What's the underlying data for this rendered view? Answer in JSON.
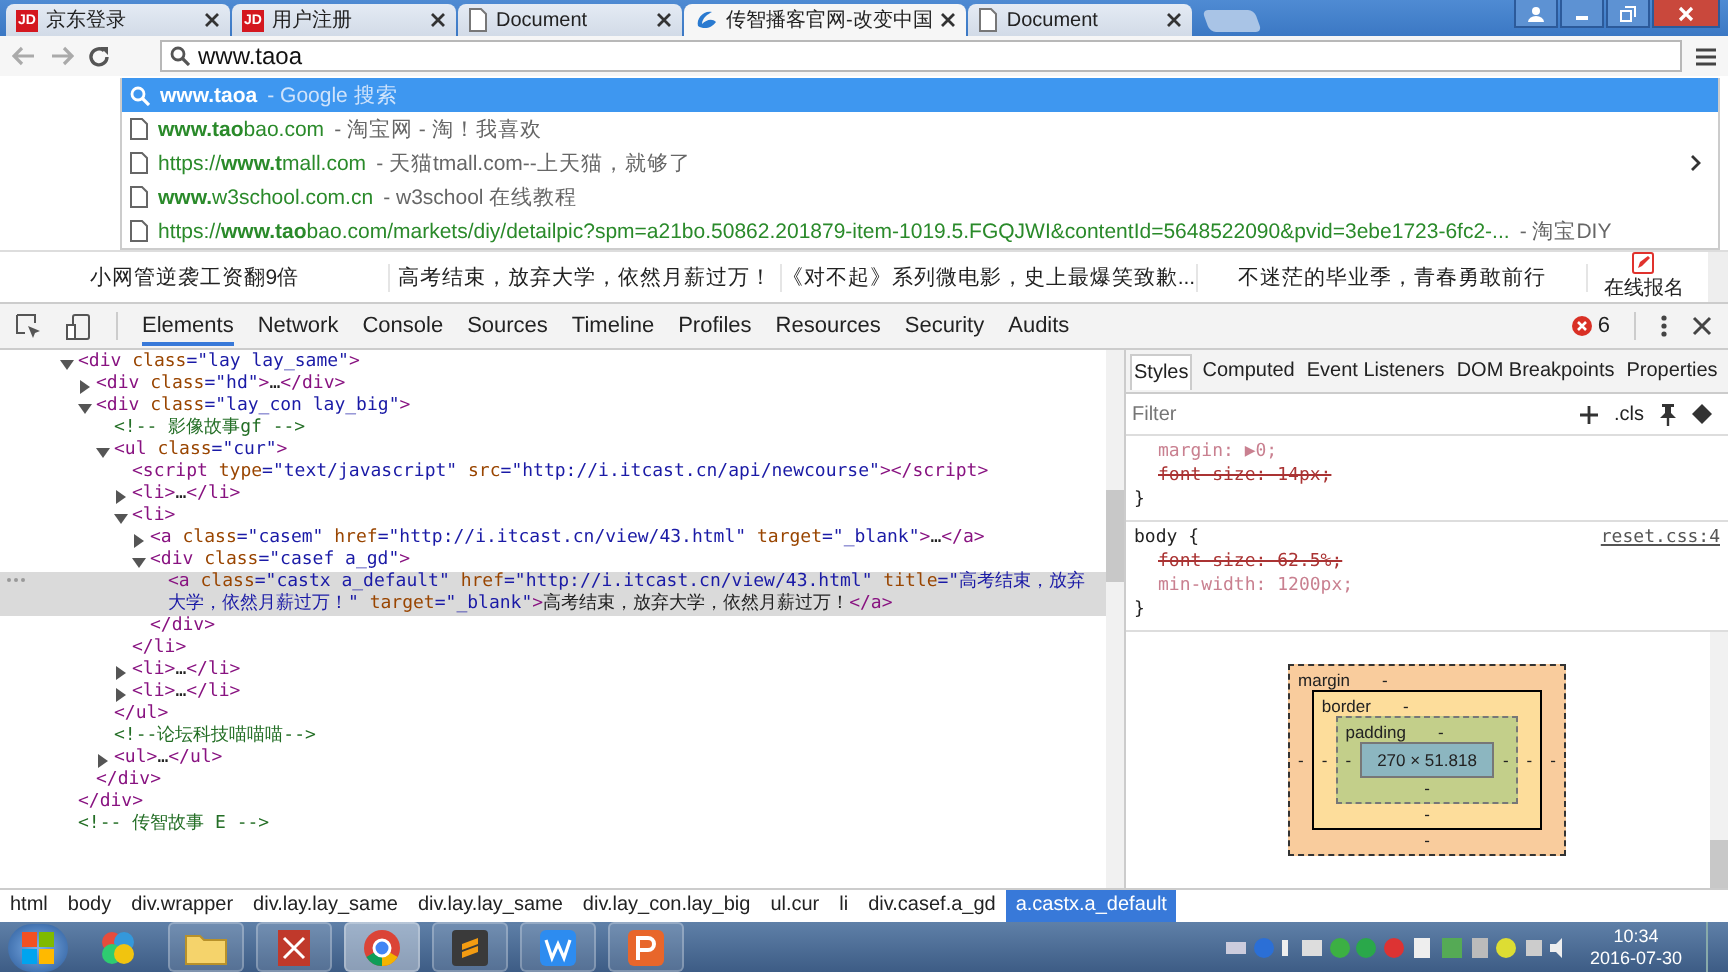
{
  "browser": {
    "tabs": [
      {
        "title": "京东登录",
        "kind": "logo",
        "badge": "JD",
        "selected": false
      },
      {
        "title": "用户注册",
        "kind": "logo",
        "badge": "JD",
        "selected": false
      },
      {
        "title": "Document",
        "kind": "document",
        "selected": false
      },
      {
        "title": "传智播客官网-改变中国",
        "kind": "swirl",
        "selected": true
      },
      {
        "title": "Document",
        "kind": "document",
        "selected": false
      }
    ],
    "omnibox": {
      "value": "www.taoa"
    },
    "suggestions": [
      {
        "kind": "search",
        "text": "**www.taoa**",
        "description": " - Google 搜索",
        "selected": true,
        "arrow": false
      },
      {
        "kind": "page",
        "text": "**www.tao**bao.com",
        "description": " - 淘宝网 - 淘！我喜欢",
        "selected": false,
        "arrow": false
      },
      {
        "kind": "page",
        "text": "https://**www.t**mall.com",
        "description": " - 天猫tmall.com--上天猫，就够了",
        "selected": false,
        "arrow": true
      },
      {
        "kind": "page",
        "text": "**www.**w3school.com.cn",
        "description": " - w3school 在线教程",
        "selected": false,
        "arrow": false
      },
      {
        "kind": "page",
        "text": "https://**www.tao**bao.com/markets/diy/detailpic?spm=a21bo.50862.201879-item-1019.5.FGQJWI&contentId=5648522090&pvid=3ebe1723-6fc2-...",
        "description": " - 淘宝DIY",
        "selected": false,
        "arrow": false
      }
    ]
  },
  "page": {
    "headlines": [
      "小网管逆袭工资翻9倍",
      "高考结束，放弃大学，依然月薪过万！",
      "《对不起》系列微电影，史上最爆笑致歉...",
      "不迷茫的毕业季，青春勇敢前行"
    ],
    "signup": "在线报名"
  },
  "devtools": {
    "tabs": [
      {
        "label": "Elements",
        "selected": true
      },
      {
        "label": "Network",
        "selected": false
      },
      {
        "label": "Console",
        "selected": false
      },
      {
        "label": "Sources",
        "selected": false
      },
      {
        "label": "Timeline",
        "selected": false
      },
      {
        "label": "Profiles",
        "selected": false
      },
      {
        "label": "Resources",
        "selected": false
      },
      {
        "label": "Security",
        "selected": false
      },
      {
        "label": "Audits",
        "selected": false
      }
    ],
    "error_count": "6",
    "tree": [
      {
        "markup": "<div class=\"lay lay_same\">",
        "expanded": true,
        "selected": false,
        "close": "</div>",
        "children": [
          {
            "markup": "<div class=\"hd\">…</div>",
            "expanded": false,
            "selected": false
          },
          {
            "markup": "<div class=\"lay_con lay_big\">",
            "expanded": true,
            "selected": false,
            "close": "</div>",
            "children": [
              {
                "markup": "<!-- 影像故事gf -->",
                "selected": false
              },
              {
                "markup": "<ul class=\"cur\">",
                "expanded": true,
                "selected": false,
                "close": "</ul>",
                "children": [
                  {
                    "markup": "<script type=\"text/javascript\" src=\"http://i.itcast.cn/api/newcourse\"></script>",
                    "selected": false
                  },
                  {
                    "markup": "<li>…</li>",
                    "expanded": false,
                    "selected": false
                  },
                  {
                    "markup": "<li>",
                    "expanded": true,
                    "selected": false,
                    "close": "</li>",
                    "children": [
                      {
                        "markup": "<a class=\"casem\" href=\"http://i.itcast.cn/view/43.html\" target=\"_blank\">…</a>",
                        "expanded": false,
                        "selected": false
                      },
                      {
                        "markup": "<div class=\"casef a_gd\">",
                        "expanded": true,
                        "selected": false,
                        "close": "</div>",
                        "children": [
                          {
                            "markup": "<a class=\"castx a_default\" href=\"http://i.itcast.cn/view/43.html\" title=\"高考结束，放弃大学，依然月薪过万！\" target=\"_blank\">高考结束，放弃大学，依然月薪过万！</a>",
                            "selected": true
                          }
                        ]
                      }
                    ]
                  },
                  {
                    "markup": "<li>…</li>",
                    "expanded": false,
                    "selected": false
                  },
                  {
                    "markup": "<li>…</li>",
                    "expanded": false,
                    "selected": false
                  }
                ]
              },
              {
                "markup": "<!--论坛科技喵喵喵-->",
                "selected": false
              },
              {
                "markup": "<ul>…</ul>",
                "expanded": false,
                "selected": false
              }
            ]
          }
        ]
      },
      {
        "markup": "<!-- 传智故事 E -->",
        "selected": false
      }
    ],
    "breadcrumbs": [
      {
        "label": "html",
        "selected": false
      },
      {
        "label": "body",
        "selected": false
      },
      {
        "label": "div.wrapper",
        "selected": false
      },
      {
        "label": "div.lay.lay_same",
        "selected": false
      },
      {
        "label": "div.lay.lay_same",
        "selected": false
      },
      {
        "label": "div.lay_con.lay_big",
        "selected": false
      },
      {
        "label": "ul.cur",
        "selected": false
      },
      {
        "label": "li",
        "selected": false
      },
      {
        "label": "div.casef.a_gd",
        "selected": false
      },
      {
        "label": "a.castx.a_default",
        "selected": true
      }
    ],
    "side_tabs": [
      {
        "label": "Styles",
        "selected": true
      },
      {
        "label": "Computed",
        "selected": false
      },
      {
        "label": "Event Listeners",
        "selected": false
      },
      {
        "label": "DOM Breakpoints",
        "selected": false
      },
      {
        "label": "Properties",
        "selected": false
      }
    ],
    "filter": {
      "placeholder": "Filter"
    },
    "cls": ".cls",
    "rules": [
      {
        "props": [
          {
            "text": "margin: ▶0;",
            "overridden": false
          },
          {
            "text": "font-size: 14px;",
            "overridden": true
          }
        ],
        "close": "}"
      },
      {
        "open": "body {",
        "source": "reset.css:4",
        "props": [
          {
            "text": "font-size: 62.5%;",
            "overridden": true
          },
          {
            "text": "min-width: 1200px;",
            "overridden": false
          }
        ],
        "close": "}"
      }
    ],
    "box_model": {
      "margin": {
        "label": "margin",
        "top": "-",
        "right": "-",
        "bottom": "-",
        "left": "-"
      },
      "border": {
        "label": "border",
        "top": "-",
        "right": "-",
        "bottom": "-",
        "left": "-"
      },
      "padding": {
        "label": "padding",
        "top": "-",
        "right": "-",
        "bottom": "-",
        "left": "-"
      },
      "content": "270 × 51.818"
    }
  },
  "taskbar": {
    "apps": [
      {
        "kind": "folder",
        "active": false
      },
      {
        "kind": "pdf",
        "active": false
      },
      {
        "kind": "browser",
        "active": true
      },
      {
        "kind": "editor",
        "active": false
      },
      {
        "kind": "writer",
        "active": false
      },
      {
        "kind": "slides",
        "active": false
      }
    ],
    "time": "10:34",
    "date": "2016-07-30"
  }
}
